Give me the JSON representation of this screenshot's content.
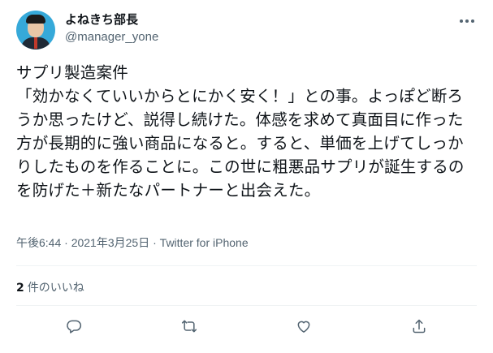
{
  "user": {
    "display_name": "よねきち部長",
    "handle": "@manager_yone"
  },
  "tweet": {
    "text": "サプリ製造案件\n「効かなくていいからとにかく安く！」との事。よっぽど断ろうか思ったけど、説得し続けた。体感を求めて真面目に作った方が長期的に強い商品になると。すると、単価を上げてしっかりしたものを作ることに。この世に粗悪品サプリが誕生するのを防げた＋新たなパートナーと出会えた。",
    "time": "午後6:44",
    "separator1": " · ",
    "date": "2021年3月25日",
    "separator2": " · ",
    "source": "Twitter for iPhone"
  },
  "stats": {
    "likes_count": "2",
    "likes_label": "件のいいね"
  },
  "icons": {
    "more": "more-dots-icon",
    "reply": "reply-icon",
    "retweet": "retweet-icon",
    "like": "heart-icon",
    "share": "share-icon"
  },
  "colors": {
    "text": "#0f1419",
    "secondary": "#536471",
    "divider": "#eff3f4"
  }
}
